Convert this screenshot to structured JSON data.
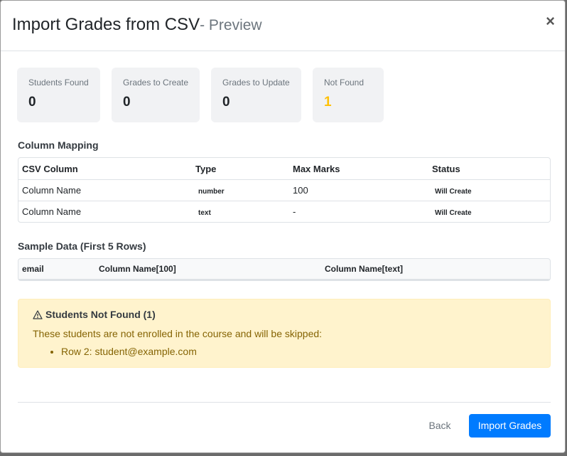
{
  "header": {
    "title": "Import Grades from CSV",
    "subtitle": "- Preview",
    "close_label": "×"
  },
  "stats": [
    {
      "label": "Students Found",
      "value": "0"
    },
    {
      "label": "Grades to Create",
      "value": "0"
    },
    {
      "label": "Grades to Update",
      "value": "0"
    },
    {
      "label": "Not Found",
      "value": "1"
    }
  ],
  "mapping": {
    "title": "Column Mapping",
    "headers": [
      "CSV Column",
      "Type",
      "Max Marks",
      "Status"
    ],
    "rows": [
      {
        "column": "Column Name",
        "type": "number",
        "max": "100",
        "status": "Will Create"
      },
      {
        "column": "Column Name",
        "type": "text",
        "max": "-",
        "status": "Will Create"
      }
    ]
  },
  "sample": {
    "title": "Sample Data (First 5 Rows)",
    "headers": [
      "email",
      "Column Name[100]",
      "Column Name[text]"
    ]
  },
  "alert": {
    "title": "Students Not Found (1)",
    "description": "These students are not enrolled in the course and will be skipped:",
    "items": [
      "Row 2: student@example.com"
    ]
  },
  "footer": {
    "back_label": "Back",
    "import_label": "Import Grades"
  },
  "colors": {
    "primary": "#007bff",
    "warning": "#ffc107",
    "alert_bg": "#fff3cd"
  }
}
